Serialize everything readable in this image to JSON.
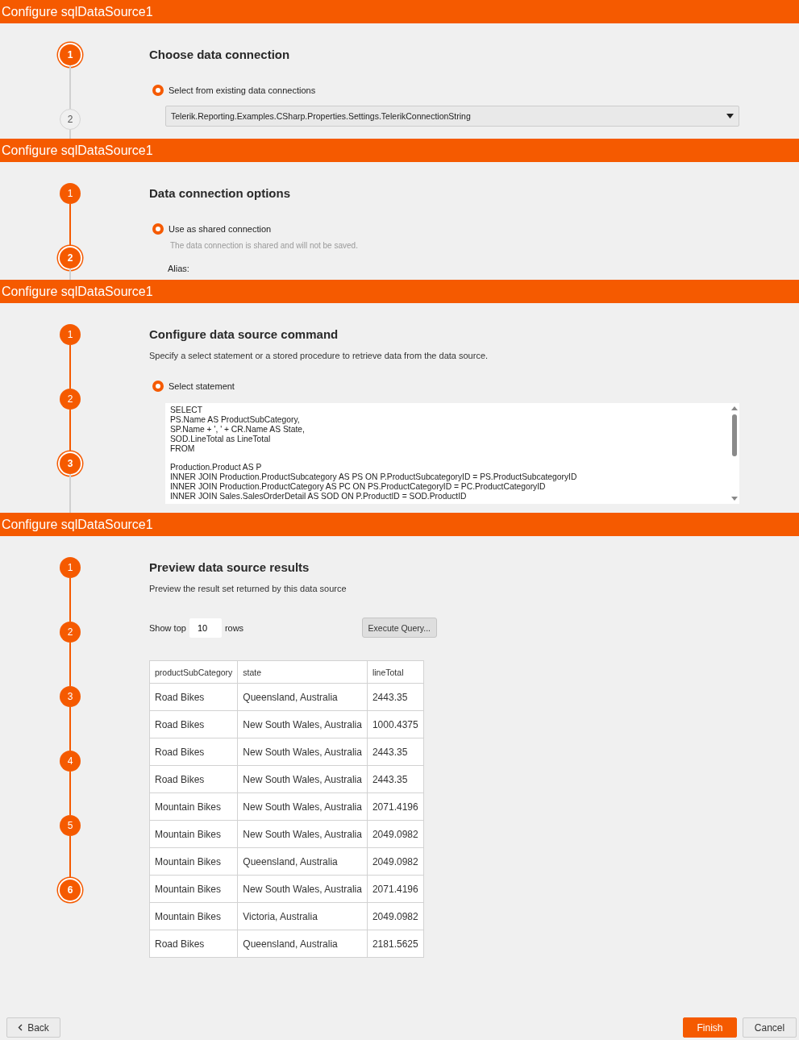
{
  "panels": [
    {
      "kind": "connection",
      "title": "Configure sqlDataSource1",
      "steps": [
        {
          "label": "1",
          "selected": true
        },
        {
          "label": "2",
          "selected": false
        }
      ],
      "heading": "Choose data connection",
      "radio": {
        "label": "Select from existing data connections",
        "selected": true
      },
      "dropdown": {
        "value": "Telerik.Reporting.Examples.CSharp.Properties.Settings.TelerikConnectionString"
      }
    },
    {
      "kind": "options",
      "title": "Configure sqlDataSource1",
      "steps": [
        {
          "label": "1",
          "selected": false
        },
        {
          "label": "2",
          "selected": true
        }
      ],
      "heading": "Data connection options",
      "radio": {
        "label": "Use as shared connection",
        "selected": true
      },
      "note": "The data connection is shared and will not be saved.",
      "alias_label": "Alias:"
    },
    {
      "kind": "command",
      "title": "Configure sqlDataSource1",
      "steps": [
        {
          "label": "1",
          "selected": false
        },
        {
          "label": "2",
          "selected": false
        },
        {
          "label": "3",
          "selected": true
        }
      ],
      "heading": "Configure data source command",
      "description": "Specify a select statement or a stored procedure to retrieve data from the data source.",
      "radio": {
        "label": "Select statement",
        "selected": true
      },
      "sql": "SELECT\nPS.Name AS ProductSubCategory,\nSP.Name + ', ' + CR.Name AS State,\nSOD.LineTotal as LineTotal\nFROM\n\nProduction.Product AS P\nINNER JOIN Production.ProductSubcategory AS PS ON P.ProductSubcategoryID = PS.ProductSubcategoryID\nINNER JOIN Production.ProductCategory AS PC ON PS.ProductCategoryID = PC.ProductCategoryID\nINNER JOIN Sales.SalesOrderDetail AS SOD ON P.ProductID = SOD.ProductID"
    },
    {
      "kind": "preview",
      "title": "Configure sqlDataSource1",
      "steps": [
        {
          "label": "1",
          "selected": false
        },
        {
          "label": "2",
          "selected": false
        },
        {
          "label": "3",
          "selected": false
        },
        {
          "label": "4",
          "selected": false
        },
        {
          "label": "5",
          "selected": false
        },
        {
          "label": "6",
          "selected": true
        }
      ],
      "heading": "Preview data source results",
      "description": "Preview the result set returned by this data source",
      "show_top_label": "Show top",
      "rows_value": "10",
      "rows_label": "rows",
      "execute_button": "Execute Query...",
      "table": {
        "columns": [
          "productSubCategory",
          "state",
          "lineTotal"
        ],
        "rows": [
          [
            "Road Bikes",
            "Queensland, Australia",
            "2443.35"
          ],
          [
            "Road Bikes",
            "New South Wales, Australia",
            "1000.4375"
          ],
          [
            "Road Bikes",
            "New South Wales, Australia",
            "2443.35"
          ],
          [
            "Road Bikes",
            "New South Wales, Australia",
            "2443.35"
          ],
          [
            "Mountain Bikes",
            "New South Wales, Australia",
            "2071.4196"
          ],
          [
            "Mountain Bikes",
            "New South Wales, Australia",
            "2049.0982"
          ],
          [
            "Mountain Bikes",
            "Queensland, Australia",
            "2049.0982"
          ],
          [
            "Mountain Bikes",
            "New South Wales, Australia",
            "2071.4196"
          ],
          [
            "Mountain Bikes",
            "Victoria, Australia",
            "2049.0982"
          ],
          [
            "Road Bikes",
            "Queensland, Australia",
            "2181.5625"
          ]
        ]
      },
      "buttons": [
        {
          "label": "Back",
          "kind": "back"
        },
        {
          "label": "Finish",
          "kind": "primary"
        },
        {
          "label": "Cancel",
          "kind": "secondary"
        }
      ]
    }
  ]
}
